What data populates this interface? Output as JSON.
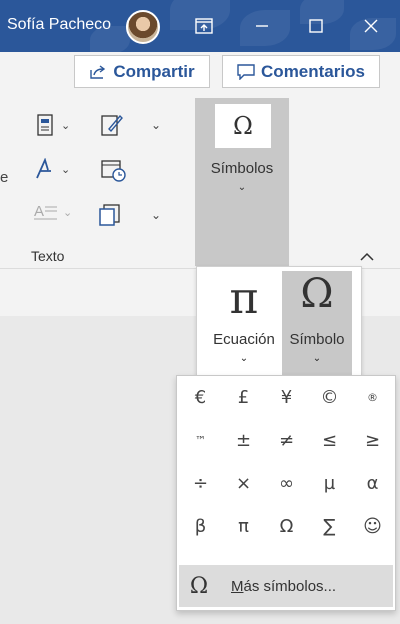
{
  "titlebar": {
    "user_name": "Sofía Pacheco",
    "bg_color": "#2b579a",
    "buttons": [
      "present-icon",
      "minimize-icon",
      "maximize-icon",
      "close-icon"
    ]
  },
  "ribbon": {
    "share_label": "Compartir",
    "comments_label": "Comentarios",
    "group_label": "Texto",
    "edge_text": "e",
    "symbols_label": "Símbolos",
    "symbols_glyph": "Ω"
  },
  "equation_panel": {
    "equation_label": "Ecuación",
    "equation_glyph": "π",
    "symbol_label": "Símbolo",
    "symbol_glyph": "Ω"
  },
  "gallery": {
    "symbols": [
      "€",
      "£",
      "¥",
      "©",
      "®",
      "™",
      "±",
      "≠",
      "≤",
      "≥",
      "÷",
      "×",
      "∞",
      "µ",
      "α",
      "β",
      "π",
      "Ω",
      "∑",
      "☺"
    ],
    "more_prefix": "M",
    "more_rest": "ás símbolos...",
    "more_glyph": "Ω"
  }
}
